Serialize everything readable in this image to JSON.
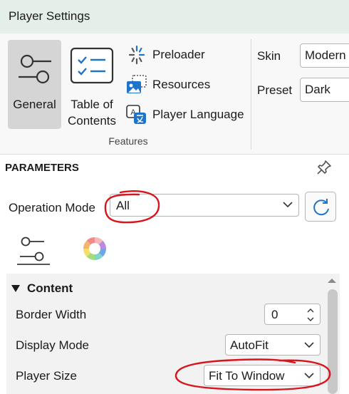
{
  "window": {
    "title": "Player Settings"
  },
  "ribbon": {
    "general": {
      "label": "General",
      "icon": "toggle-sliders-icon"
    },
    "toc": {
      "label": "Table of Contents",
      "icon": "checklist-icon"
    },
    "preloader": {
      "label": "Preloader",
      "icon": "spinner-icon"
    },
    "resources": {
      "label": "Resources",
      "icon": "image-icon"
    },
    "player_language": {
      "label": "Player Language",
      "icon": "translate-icon"
    },
    "group_label": "Features",
    "skin": {
      "label": "Skin",
      "value": "Modern"
    },
    "preset": {
      "label": "Preset",
      "value": "Dark"
    }
  },
  "panel": {
    "title": "PARAMETERS",
    "operation_mode": {
      "label": "Operation Mode",
      "value": "All"
    },
    "tabs": [
      {
        "name": "layout",
        "icon": "toggle-sliders-icon",
        "active": true
      },
      {
        "name": "colors",
        "icon": "color-wheel-icon",
        "active": false
      }
    ],
    "section": "Content",
    "border_width": {
      "label": "Border Width",
      "value": "0"
    },
    "display_mode": {
      "label": "Display Mode",
      "value": "AutoFit"
    },
    "player_size": {
      "label": "Player Size",
      "value": "Fit To Window"
    }
  },
  "colors": {
    "titlebar": "#e3efe8",
    "accent": "#1f74c9",
    "annotation": "#d8141d"
  }
}
